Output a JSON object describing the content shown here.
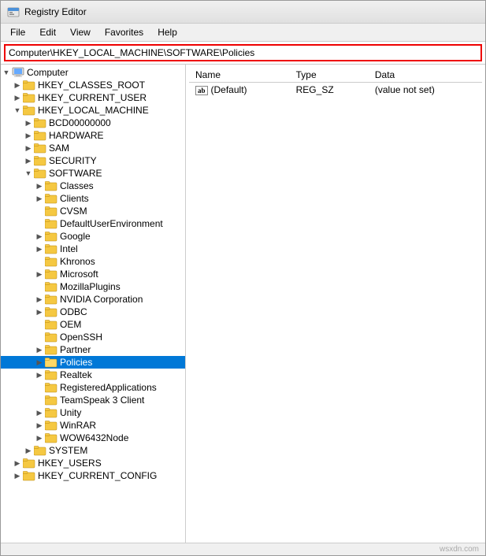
{
  "window": {
    "title": "Registry Editor",
    "icon": "registry-icon"
  },
  "menu": {
    "items": [
      "File",
      "Edit",
      "View",
      "Favorites",
      "Help"
    ]
  },
  "address_bar": {
    "value": "Computer\\HKEY_LOCAL_MACHINE\\SOFTWARE\\Policies"
  },
  "tree": {
    "nodes": [
      {
        "id": "computer",
        "label": "Computer",
        "level": 0,
        "expanded": true,
        "toggle": "▼",
        "type": "computer"
      },
      {
        "id": "hkey_classes_root",
        "label": "HKEY_CLASSES_ROOT",
        "level": 1,
        "expanded": false,
        "toggle": "▶"
      },
      {
        "id": "hkey_current_user",
        "label": "HKEY_CURRENT_USER",
        "level": 1,
        "expanded": false,
        "toggle": "▶"
      },
      {
        "id": "hkey_local_machine",
        "label": "HKEY_LOCAL_MACHINE",
        "level": 1,
        "expanded": true,
        "toggle": "▼"
      },
      {
        "id": "bcd",
        "label": "BCD00000000",
        "level": 2,
        "expanded": false,
        "toggle": "▶"
      },
      {
        "id": "hardware",
        "label": "HARDWARE",
        "level": 2,
        "expanded": false,
        "toggle": "▶"
      },
      {
        "id": "sam",
        "label": "SAM",
        "level": 2,
        "expanded": false,
        "toggle": "▶"
      },
      {
        "id": "security",
        "label": "SECURITY",
        "level": 2,
        "expanded": false,
        "toggle": "▶"
      },
      {
        "id": "software",
        "label": "SOFTWARE",
        "level": 2,
        "expanded": true,
        "toggle": "▼"
      },
      {
        "id": "classes",
        "label": "Classes",
        "level": 3,
        "expanded": false,
        "toggle": "▶"
      },
      {
        "id": "clients",
        "label": "Clients",
        "level": 3,
        "expanded": false,
        "toggle": "▶"
      },
      {
        "id": "cvsm",
        "label": "CVSM",
        "level": 3,
        "expanded": false,
        "toggle": ""
      },
      {
        "id": "defaultuserenv",
        "label": "DefaultUserEnvironment",
        "level": 3,
        "expanded": false,
        "toggle": ""
      },
      {
        "id": "google",
        "label": "Google",
        "level": 3,
        "expanded": false,
        "toggle": "▶"
      },
      {
        "id": "intel",
        "label": "Intel",
        "level": 3,
        "expanded": false,
        "toggle": "▶"
      },
      {
        "id": "khronos",
        "label": "Khronos",
        "level": 3,
        "expanded": false,
        "toggle": ""
      },
      {
        "id": "microsoft",
        "label": "Microsoft",
        "level": 3,
        "expanded": false,
        "toggle": "▶"
      },
      {
        "id": "mozillaplugins",
        "label": "MozillaPlugins",
        "level": 3,
        "expanded": false,
        "toggle": ""
      },
      {
        "id": "nvidia",
        "label": "NVIDIA Corporation",
        "level": 3,
        "expanded": false,
        "toggle": "▶"
      },
      {
        "id": "odbc",
        "label": "ODBC",
        "level": 3,
        "expanded": false,
        "toggle": "▶"
      },
      {
        "id": "oem",
        "label": "OEM",
        "level": 3,
        "expanded": false,
        "toggle": ""
      },
      {
        "id": "openssh",
        "label": "OpenSSH",
        "level": 3,
        "expanded": false,
        "toggle": ""
      },
      {
        "id": "partner",
        "label": "Partner",
        "level": 3,
        "expanded": false,
        "toggle": "▶"
      },
      {
        "id": "policies",
        "label": "Policies",
        "level": 3,
        "expanded": false,
        "toggle": "▶",
        "selected": true
      },
      {
        "id": "realtek",
        "label": "Realtek",
        "level": 3,
        "expanded": false,
        "toggle": "▶"
      },
      {
        "id": "registeredapps",
        "label": "RegisteredApplications",
        "level": 3,
        "expanded": false,
        "toggle": ""
      },
      {
        "id": "teamspeak",
        "label": "TeamSpeak 3 Client",
        "level": 3,
        "expanded": false,
        "toggle": ""
      },
      {
        "id": "unity",
        "label": "Unity",
        "level": 3,
        "expanded": false,
        "toggle": "▶"
      },
      {
        "id": "winrar",
        "label": "WinRAR",
        "level": 3,
        "expanded": false,
        "toggle": "▶"
      },
      {
        "id": "wow6432",
        "label": "WOW6432Node",
        "level": 3,
        "expanded": false,
        "toggle": "▶"
      },
      {
        "id": "system",
        "label": "SYSTEM",
        "level": 2,
        "expanded": false,
        "toggle": "▶"
      },
      {
        "id": "hkey_users",
        "label": "HKEY_USERS",
        "level": 1,
        "expanded": false,
        "toggle": "▶"
      },
      {
        "id": "hkey_current_config",
        "label": "HKEY_CURRENT_CONFIG",
        "level": 1,
        "expanded": false,
        "toggle": "▶"
      }
    ]
  },
  "detail": {
    "columns": [
      "Name",
      "Type",
      "Data"
    ],
    "rows": [
      {
        "name": "(Default)",
        "type": "REG_SZ",
        "data": "(value not set)",
        "icon": "ab-icon"
      }
    ]
  },
  "watermark": "wsxdn.com"
}
